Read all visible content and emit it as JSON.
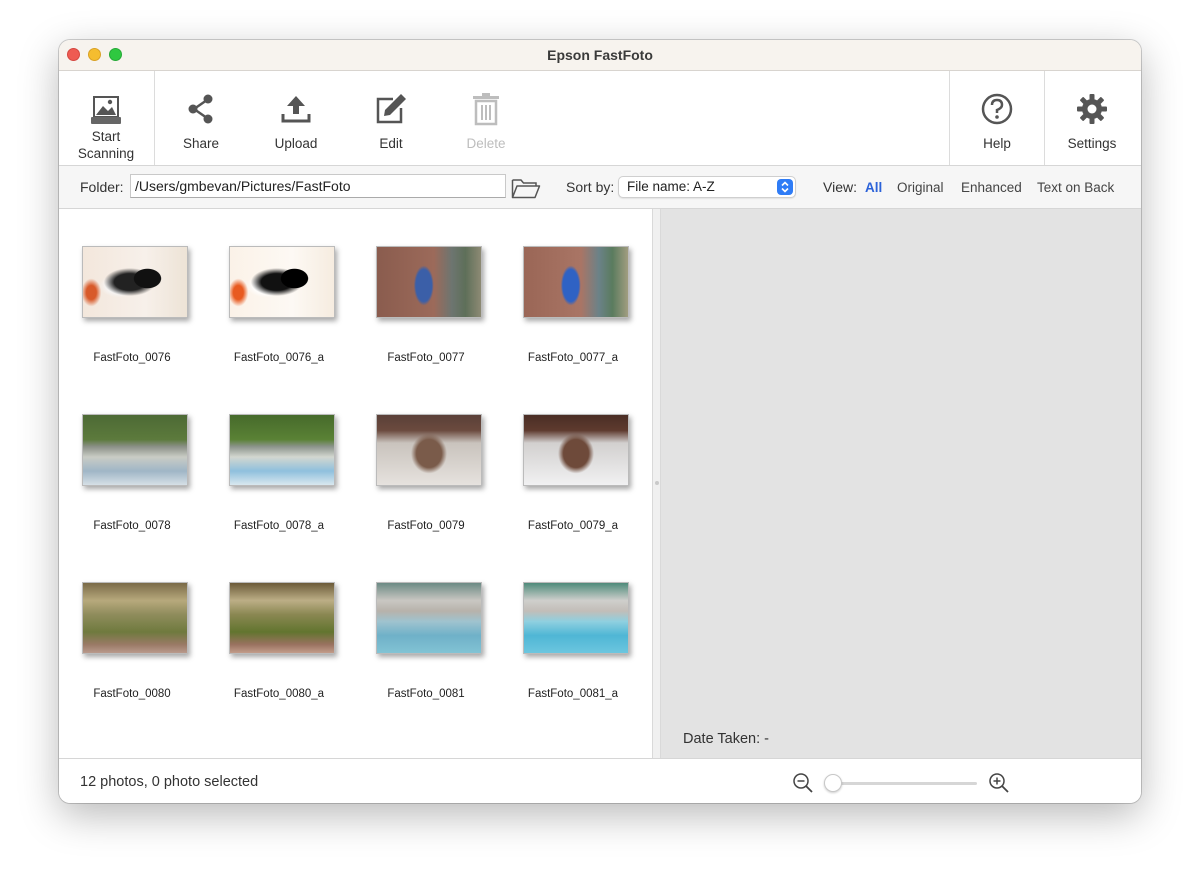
{
  "window": {
    "title": "Epson FastFoto"
  },
  "toolbar": {
    "start_scanning": "Start\nScanning",
    "start_line1": "Start",
    "start_line2": "Scanning",
    "share": "Share",
    "upload": "Upload",
    "edit": "Edit",
    "delete": "Delete",
    "help": "Help",
    "settings": "Settings"
  },
  "folderbar": {
    "folder_label": "Folder:",
    "folder_path": "/Users/gmbevan/Pictures/FastFoto",
    "sort_label": "Sort by:",
    "sort_value": "File name: A-Z",
    "view_label": "View:",
    "view_options": [
      "All",
      "Original",
      "Enhanced",
      "Text on Back"
    ],
    "view_selected": "All"
  },
  "gallery": {
    "photos": [
      {
        "name": "FastFoto_0076",
        "subject": "cat"
      },
      {
        "name": "FastFoto_0076_a",
        "subject": "cat"
      },
      {
        "name": "FastFoto_0077",
        "subject": "person-blue"
      },
      {
        "name": "FastFoto_0077_a",
        "subject": "person-blue"
      },
      {
        "name": "FastFoto_0078",
        "subject": "street-grass"
      },
      {
        "name": "FastFoto_0078_a",
        "subject": "street-grass"
      },
      {
        "name": "FastFoto_0079",
        "subject": "tree-upside"
      },
      {
        "name": "FastFoto_0079_a",
        "subject": "tree-upside"
      },
      {
        "name": "FastFoto_0080",
        "subject": "field-trees"
      },
      {
        "name": "FastFoto_0080_a",
        "subject": "field-trees"
      },
      {
        "name": "FastFoto_0081",
        "subject": "pool"
      },
      {
        "name": "FastFoto_0081_a",
        "subject": "pool"
      }
    ]
  },
  "preview": {
    "date_taken": "Date Taken: -"
  },
  "status": {
    "summary": "12 photos, 0 photo selected",
    "zoom_level": 0.0
  },
  "colors": {
    "accent": "#2b62d9",
    "select_arrows": "#2f7cf6"
  }
}
